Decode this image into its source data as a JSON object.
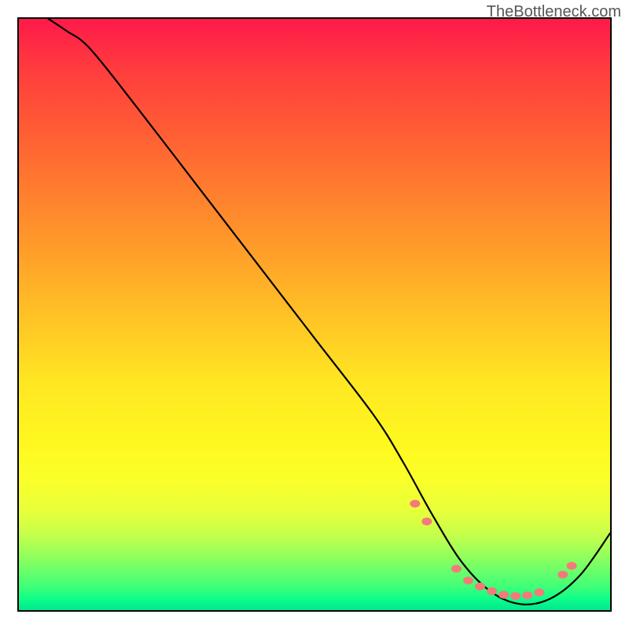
{
  "watermark": "TheBottleneck.com",
  "chart_data": {
    "type": "line",
    "title": "",
    "xlabel": "",
    "ylabel": "",
    "xlim": [
      0,
      100
    ],
    "ylim": [
      0,
      100
    ],
    "gradient_stops": [
      {
        "pct": 0,
        "color": "#ff1a4a"
      },
      {
        "pct": 8,
        "color": "#ff3a3f"
      },
      {
        "pct": 18,
        "color": "#ff5a35"
      },
      {
        "pct": 28,
        "color": "#ff7a2f"
      },
      {
        "pct": 40,
        "color": "#ffa029"
      },
      {
        "pct": 52,
        "color": "#ffc825"
      },
      {
        "pct": 62,
        "color": "#ffe822"
      },
      {
        "pct": 72,
        "color": "#fff820"
      },
      {
        "pct": 78,
        "color": "#faff2a"
      },
      {
        "pct": 83,
        "color": "#e8ff3a"
      },
      {
        "pct": 87,
        "color": "#c8ff4a"
      },
      {
        "pct": 90,
        "color": "#a0ff58"
      },
      {
        "pct": 93,
        "color": "#70ff68"
      },
      {
        "pct": 96,
        "color": "#40ff78"
      },
      {
        "pct": 98,
        "color": "#10ff88"
      },
      {
        "pct": 100,
        "color": "#00e890"
      }
    ],
    "series": [
      {
        "name": "bottleneck-curve",
        "x": [
          5,
          8,
          12,
          20,
          30,
          40,
          50,
          60,
          65,
          70,
          75,
          80,
          85,
          90,
          95,
          100
        ],
        "y": [
          100,
          98,
          95,
          85,
          72,
          59,
          46,
          33,
          25,
          16,
          8,
          3,
          1,
          2,
          6,
          13
        ]
      }
    ],
    "markers": {
      "name": "highlight-dots",
      "color": "#f47a7a",
      "points": [
        {
          "x": 67,
          "y": 18
        },
        {
          "x": 69,
          "y": 15
        },
        {
          "x": 74,
          "y": 7
        },
        {
          "x": 76,
          "y": 5
        },
        {
          "x": 78,
          "y": 4
        },
        {
          "x": 80,
          "y": 3.2
        },
        {
          "x": 82,
          "y": 2.6
        },
        {
          "x": 84,
          "y": 2.4
        },
        {
          "x": 86,
          "y": 2.5
        },
        {
          "x": 88,
          "y": 3
        },
        {
          "x": 92,
          "y": 6
        },
        {
          "x": 93.5,
          "y": 7.5
        }
      ]
    }
  }
}
